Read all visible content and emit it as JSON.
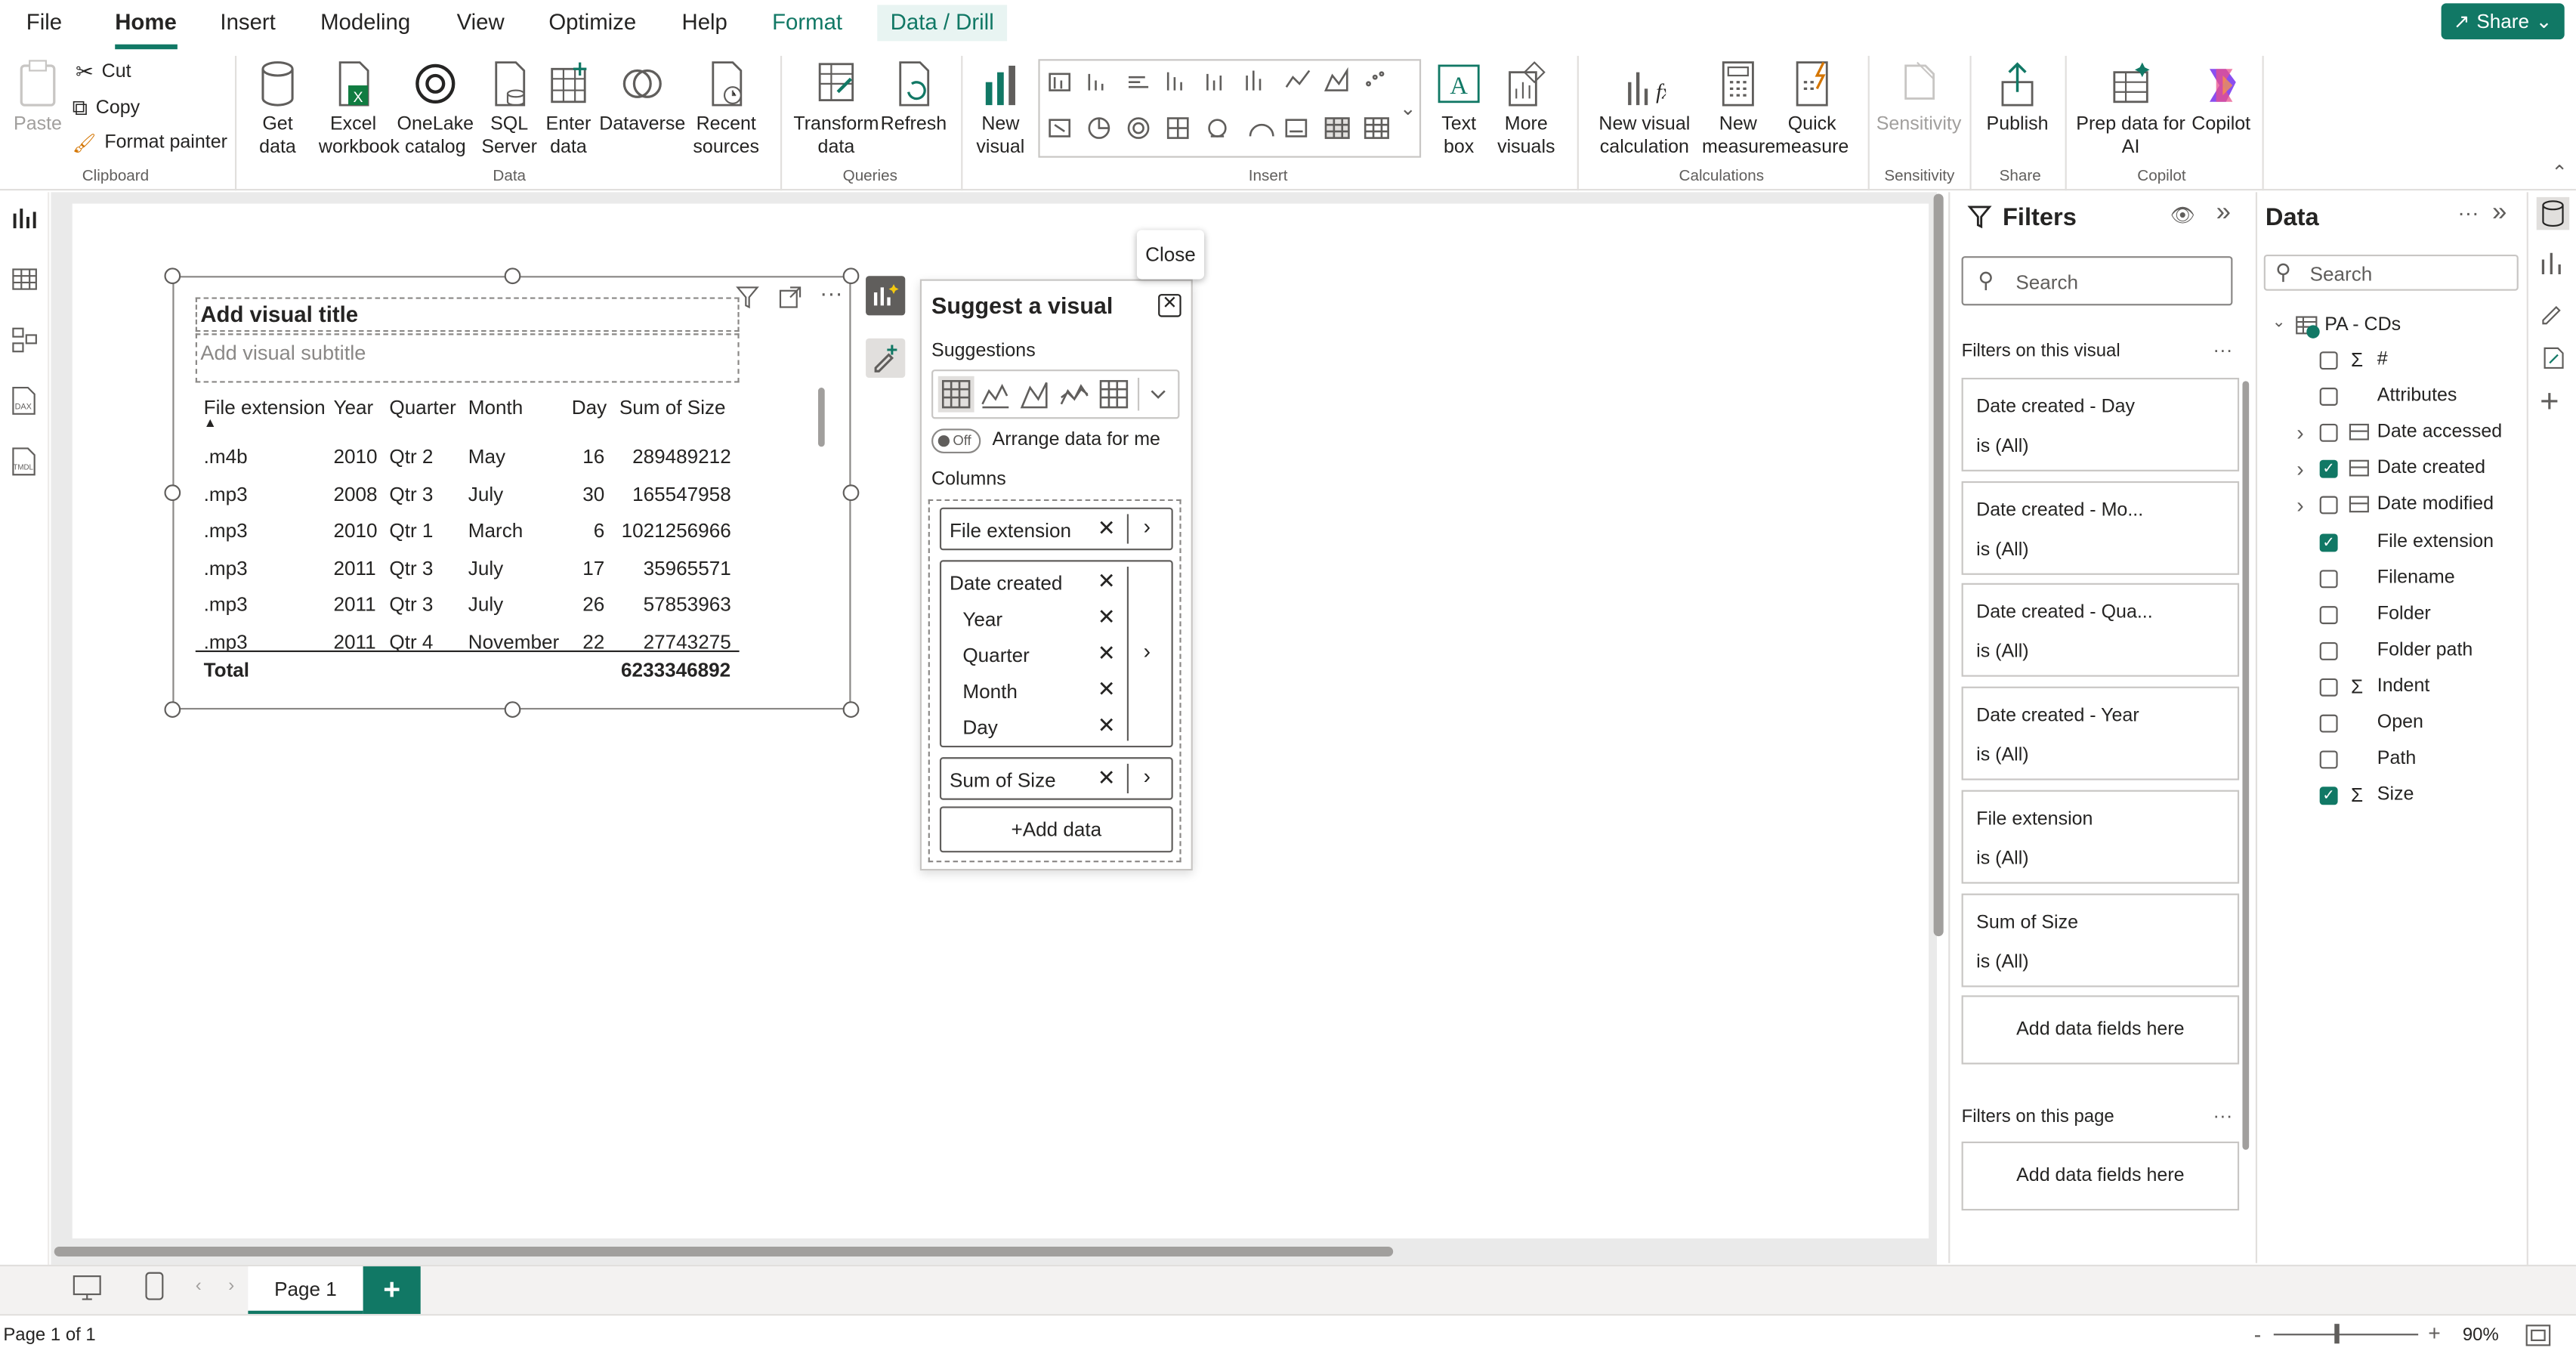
{
  "tabs": [
    "File",
    "Home",
    "Insert",
    "Modeling",
    "View",
    "Optimize",
    "Help",
    "Format",
    "Data / Drill"
  ],
  "share_label": "Share",
  "clipboard": {
    "paste": "Paste",
    "cut": "Cut",
    "copy": "Copy",
    "format_painter": "Format painter",
    "group": "Clipboard"
  },
  "data_group": {
    "get_data": "Get data",
    "excel": "Excel workbook",
    "onelake": "OneLake catalog",
    "sql": "SQL Server",
    "enter": "Enter data",
    "dataverse": "Dataverse",
    "recent": "Recent sources",
    "group": "Data"
  },
  "queries": {
    "transform": "Transform data",
    "refresh": "Refresh",
    "group": "Queries"
  },
  "insert": {
    "new_visual": "New visual",
    "text_box": "Text box",
    "more_visuals": "More visuals",
    "group": "Insert"
  },
  "calculations": {
    "new_visual_calc": "New visual calculation",
    "new_measure": "New measure",
    "quick_measure": "Quick measure",
    "group": "Calculations"
  },
  "sensitivity": {
    "label": "Sensitivity",
    "group": "Sensitivity"
  },
  "share": {
    "publish": "Publish",
    "group": "Share"
  },
  "copilot": {
    "prep": "Prep data for AI",
    "copilot": "Copilot",
    "group": "Copilot"
  },
  "visual": {
    "title_placeholder": "Add visual title",
    "subtitle_placeholder": "Add visual subtitle",
    "columns": [
      "File extension",
      "Year",
      "Quarter",
      "Month",
      "Day",
      "Sum of Size"
    ],
    "rows": [
      [
        ".m4b",
        "2010",
        "Qtr 2",
        "May",
        "16",
        "289489212"
      ],
      [
        ".mp3",
        "2008",
        "Qtr 3",
        "July",
        "30",
        "165547958"
      ],
      [
        ".mp3",
        "2010",
        "Qtr 1",
        "March",
        "6",
        "1021256966"
      ],
      [
        ".mp3",
        "2011",
        "Qtr 3",
        "July",
        "17",
        "35965571"
      ],
      [
        ".mp3",
        "2011",
        "Qtr 3",
        "July",
        "26",
        "57853963"
      ],
      [
        ".mp3",
        "2011",
        "Qtr 4",
        "November",
        "22",
        "27743275"
      ]
    ],
    "total_label": "Total",
    "total_value": "6233346892"
  },
  "suggest": {
    "title": "Suggest a visual",
    "suggestions_label": "Suggestions",
    "toggle_state": "Off",
    "arrange_label": "Arrange data for me",
    "columns_label": "Columns",
    "file_extension": "File extension",
    "date_created": "Date created",
    "date_parts": [
      "Year",
      "Quarter",
      "Month",
      "Day"
    ],
    "sum_of_size": "Sum of Size",
    "add_data": "+Add data",
    "close_tip": "Close"
  },
  "filters": {
    "title": "Filters",
    "search_placeholder": "Search",
    "on_visual": "Filters on this visual",
    "cards": [
      {
        "name": "Date created - Day",
        "value": "is (All)"
      },
      {
        "name": "Date created - Mo...",
        "value": "is (All)"
      },
      {
        "name": "Date created - Qua...",
        "value": "is (All)"
      },
      {
        "name": "Date created - Year",
        "value": "is (All)"
      },
      {
        "name": "File extension",
        "value": "is (All)"
      },
      {
        "name": "Sum of Size",
        "value": "is (All)"
      }
    ],
    "add_fields": "Add data fields here",
    "on_page": "Filters on this page",
    "add_fields_page": "Add data fields here"
  },
  "data_pane": {
    "title": "Data",
    "search_placeholder": "Search",
    "table": "PA - CDs",
    "fields": [
      {
        "name": "#",
        "checked": false,
        "sigma": true,
        "expand": false,
        "table": false
      },
      {
        "name": "Attributes",
        "checked": false,
        "sigma": false,
        "expand": false,
        "table": false
      },
      {
        "name": "Date accessed",
        "checked": false,
        "sigma": false,
        "expand": true,
        "table": true
      },
      {
        "name": "Date created",
        "checked": true,
        "sigma": false,
        "expand": true,
        "table": true
      },
      {
        "name": "Date modified",
        "checked": false,
        "sigma": false,
        "expand": true,
        "table": true
      },
      {
        "name": "File extension",
        "checked": true,
        "sigma": false,
        "expand": false,
        "table": false
      },
      {
        "name": "Filename",
        "checked": false,
        "sigma": false,
        "expand": false,
        "table": false
      },
      {
        "name": "Folder",
        "checked": false,
        "sigma": false,
        "expand": false,
        "table": false
      },
      {
        "name": "Folder path",
        "checked": false,
        "sigma": false,
        "expand": false,
        "table": false
      },
      {
        "name": "Indent",
        "checked": false,
        "sigma": true,
        "expand": false,
        "table": false
      },
      {
        "name": "Open",
        "checked": false,
        "sigma": false,
        "expand": false,
        "table": false
      },
      {
        "name": "Path",
        "checked": false,
        "sigma": false,
        "expand": false,
        "table": false
      },
      {
        "name": "Size",
        "checked": true,
        "sigma": true,
        "expand": false,
        "table": false
      }
    ]
  },
  "pages": {
    "tab": "Page 1",
    "add": "+"
  },
  "status": {
    "page_info": "Page 1 of 1",
    "zoom": "90%",
    "minus": "-",
    "plus": "+"
  },
  "colors": {
    "accent": "#117865",
    "border": "#c8c6c4"
  }
}
